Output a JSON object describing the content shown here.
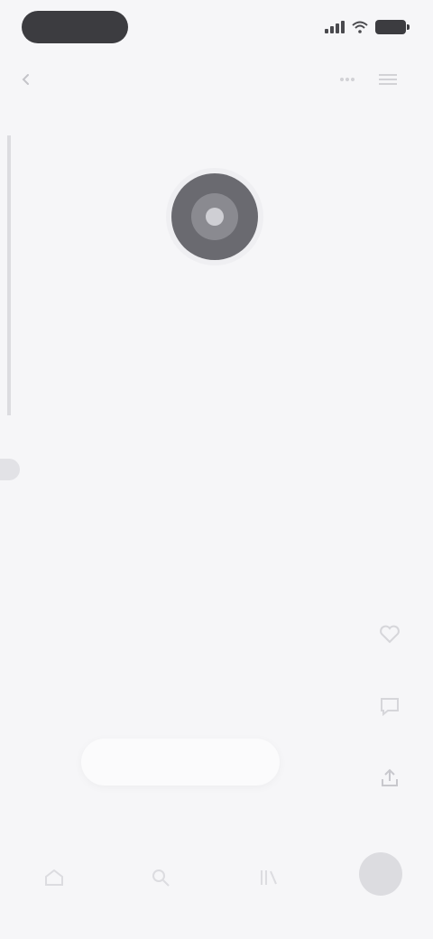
{
  "status_bar": {
    "time": ""
  },
  "top_bar": {
    "back_label": "",
    "action_labels": [
      "",
      ""
    ]
  },
  "art_caption": "",
  "lyrics": [
    "",
    "",
    "",
    ""
  ],
  "lyrics_source": "",
  "now_pill": {
    "label": ""
  },
  "pill_hint": "",
  "icons": {
    "back": "chevron-left-icon",
    "like": "heart-icon",
    "comment": "comment-icon",
    "share": "share-icon",
    "nav_home": "home-icon",
    "nav_search": "search-icon",
    "nav_library": "library-icon"
  },
  "colors": {
    "background": "#f6f6f8",
    "text": "#4e4e54",
    "status_pill": "#3c3c40"
  }
}
